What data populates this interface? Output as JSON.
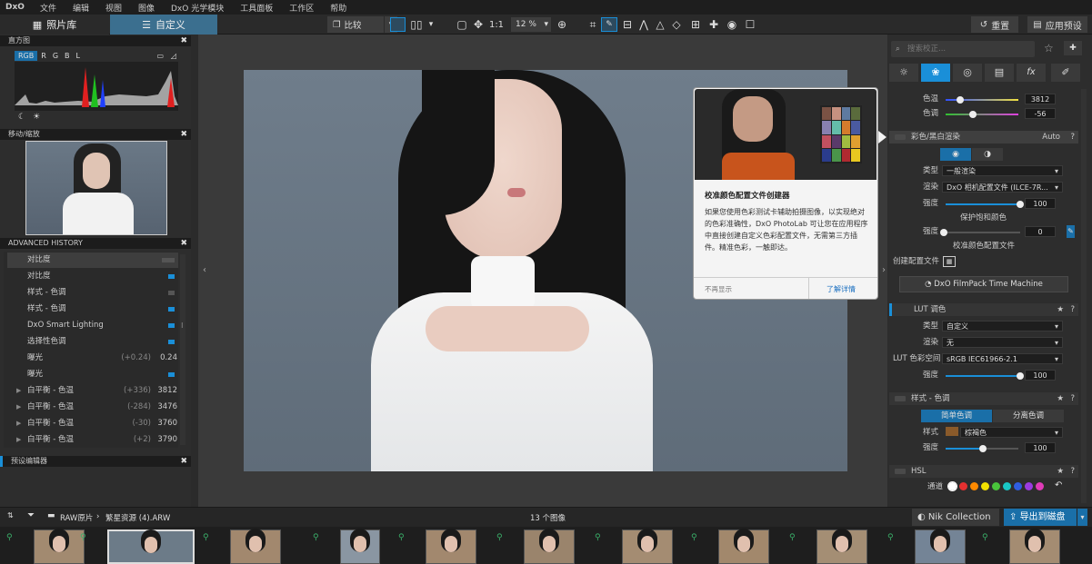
{
  "menu": {
    "logo": "DxO",
    "items": [
      "文件",
      "编辑",
      "视图",
      "图像",
      "DxO 光学模块",
      "工具面板",
      "工作区",
      "帮助"
    ]
  },
  "topbar": {
    "tab_library": "照片库",
    "tab_customize": "自定义",
    "compare": "比较",
    "ratio": "1:1",
    "zoom": "12 %",
    "reset": "重置",
    "apply_preset": "应用预设"
  },
  "left": {
    "histogram": {
      "title": "直方图",
      "channels": [
        "RGB",
        "R",
        "G",
        "B",
        "L"
      ]
    },
    "navigator": {
      "title": "移动/缩放"
    },
    "history": {
      "title": "ADVANCED HISTORY",
      "rows": [
        {
          "label": "对比度",
          "delta": "",
          "value": "",
          "state": "gray"
        },
        {
          "label": "对比度",
          "delta": "",
          "value": "",
          "state": "blue"
        },
        {
          "label": "样式 - 色调",
          "delta": "",
          "value": "",
          "state": "gray"
        },
        {
          "label": "样式 - 色调",
          "delta": "",
          "value": "",
          "state": "blue"
        },
        {
          "label": "DxO Smart Lighting",
          "delta": "",
          "value": "",
          "state": "blue"
        },
        {
          "label": "选择性色调",
          "delta": "",
          "value": "",
          "state": "blue"
        },
        {
          "label": "曝光",
          "delta": "(+0.24)",
          "value": "0.24",
          "state": ""
        },
        {
          "label": "曝光",
          "delta": "",
          "value": "",
          "state": "blue"
        },
        {
          "label": "白平衡 - 色温",
          "delta": "(+336)",
          "value": "3812",
          "state": ""
        },
        {
          "label": "白平衡 - 色温",
          "delta": "(-284)",
          "value": "3476",
          "state": ""
        },
        {
          "label": "白平衡 - 色温",
          "delta": "(-30)",
          "value": "3760",
          "state": ""
        },
        {
          "label": "白平衡 - 色温",
          "delta": "(+2)",
          "value": "3790",
          "state": ""
        }
      ]
    },
    "preset_editor": "预设编辑器"
  },
  "tooltip": {
    "title": "校准颜色配置文件创建器",
    "body": "如果您使用色彩测试卡辅助拍摄图像，以实现绝对的色彩准确性，DxO PhotoLab 可让您在应用程序中直接创建自定义色彩配置文件，无需第三方插件。精准色彩，一触即达。",
    "dismiss": "不再显示",
    "learn_more": "了解详情"
  },
  "right": {
    "search_placeholder": "搜索校正...",
    "hue": {
      "label": "色温",
      "value": "3812"
    },
    "tint": {
      "label": "色调",
      "value": "-56"
    },
    "color_render": {
      "title": "彩色/黑白渲染",
      "mode": "Auto",
      "type_label": "类型",
      "type_value": "一般渲染",
      "render_label": "渲染",
      "render_value": "DxO 相机配置文件 (ILCE-7R...",
      "intensity_label": "强度",
      "intensity_value": "100",
      "protect_title": "保护饱和颜色",
      "protect_label": "强度",
      "protect_value": "0",
      "calib_title": "校准颜色配置文件",
      "create_profile": "创建配置文件",
      "filmpack": "DxO FilmPack Time Machine"
    },
    "lut": {
      "title": "LUT 调色",
      "type_label": "类型",
      "type_value": "自定义",
      "render_label": "渲染",
      "render_value": "无",
      "space_label": "LUT 色彩空间",
      "space_value": "sRGB IEC61966-2.1",
      "intensity_label": "强度",
      "intensity_value": "100"
    },
    "style": {
      "title": "样式 - 色调",
      "tab_simple": "简单色调",
      "tab_split": "分离色调",
      "style_label": "样式",
      "style_value": "棕褐色",
      "intensity_label": "强度",
      "intensity_value": "100"
    },
    "hsl": {
      "title": "HSL",
      "channel_label": "通道",
      "colors": [
        "#ffffff",
        "#e53030",
        "#ff8a00",
        "#f2e000",
        "#49c33b",
        "#19c6c6",
        "#2f5de0",
        "#9b3be0",
        "#e03bb8"
      ]
    }
  },
  "filmstrip": {
    "path_root": "RAW原片",
    "path_file": "繁星资源 (4).ARW",
    "count": "13 个图像",
    "nik": "Nik Collection",
    "export": "导出到磁盘"
  },
  "colors": {
    "accent": "#1a8fd8",
    "bg": "#2b2b2b"
  }
}
